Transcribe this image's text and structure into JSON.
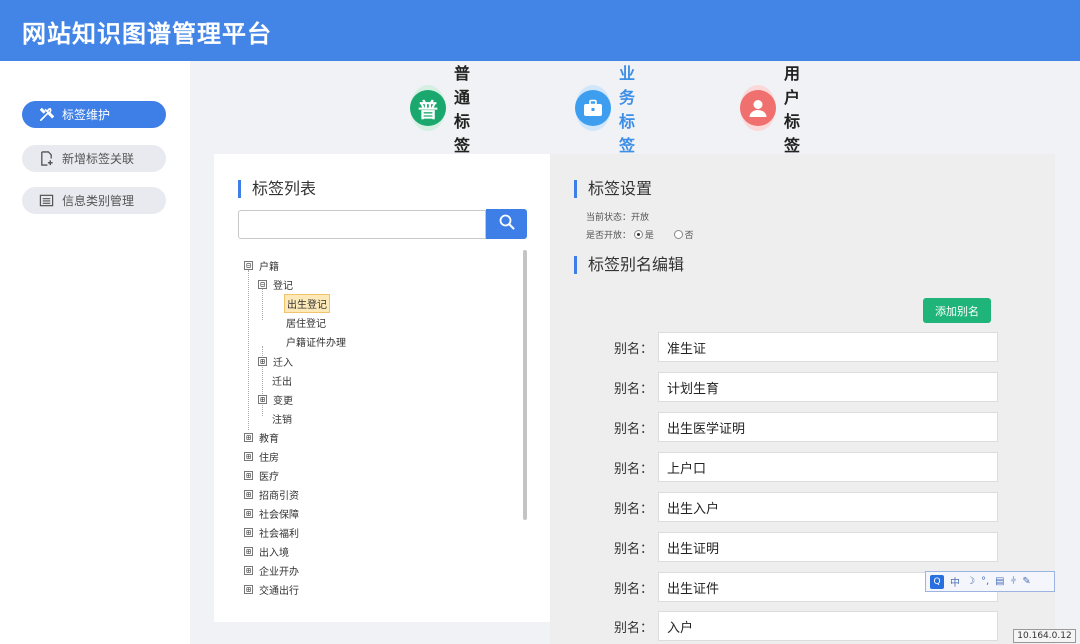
{
  "app": {
    "title": "网站知识图谱管理平台"
  },
  "sidebar": {
    "items": [
      {
        "label": "标签维护",
        "icon": "tools-icon",
        "active": true
      },
      {
        "label": "新增标签关联",
        "icon": "add-file-icon",
        "active": false
      },
      {
        "label": "信息类别管理",
        "icon": "list-icon",
        "active": false
      }
    ]
  },
  "tabs": [
    {
      "label": "普通标签",
      "glyph": "普",
      "color": "#1aa86e"
    },
    {
      "label": "业务标签",
      "icon": "briefcase-icon",
      "color": "#3d9ef0"
    },
    {
      "label": "用户标签",
      "icon": "user-icon",
      "color": "#f07070"
    }
  ],
  "tag_list": {
    "title": "标签列表",
    "search_placeholder": "",
    "tree": [
      {
        "toggle": "⊟",
        "label": "户籍"
      },
      {
        "toggle": "⊟",
        "label": "登记"
      },
      {
        "label": "出生登记",
        "selected": true
      },
      {
        "label": "居住登记"
      },
      {
        "label": "户籍证件办理"
      },
      {
        "toggle": "⊞",
        "label": "迁入"
      },
      {
        "label": "迁出"
      },
      {
        "toggle": "⊞",
        "label": "变更"
      },
      {
        "label": "注销"
      },
      {
        "toggle": "⊞",
        "label": "教育"
      },
      {
        "toggle": "⊞",
        "label": "住房"
      },
      {
        "toggle": "⊞",
        "label": "医疗"
      },
      {
        "toggle": "⊞",
        "label": "招商引资"
      },
      {
        "toggle": "⊞",
        "label": "社会保障"
      },
      {
        "toggle": "⊞",
        "label": "社会福利"
      },
      {
        "toggle": "⊞",
        "label": "出入境"
      },
      {
        "toggle": "⊞",
        "label": "企业开办"
      },
      {
        "toggle": "⊞",
        "label": "交通出行"
      }
    ]
  },
  "tag_settings": {
    "title": "标签设置",
    "status_label": "当前状态：",
    "status_value": "开放",
    "open_label": "是否开放：",
    "option_yes": "是",
    "option_no": "否",
    "open_selected": "是"
  },
  "alias_edit": {
    "title": "标签别名编辑",
    "add_button": "添加别名",
    "label": "别名：",
    "aliases": [
      "准生证",
      "计划生育",
      "出生医学证明",
      "上户口",
      "出生入户",
      "出生证明",
      "出生证件",
      "入户"
    ]
  },
  "ime": {
    "q": "Q",
    "mode": "中"
  },
  "footer": {
    "ip": "10.164.0.12"
  }
}
